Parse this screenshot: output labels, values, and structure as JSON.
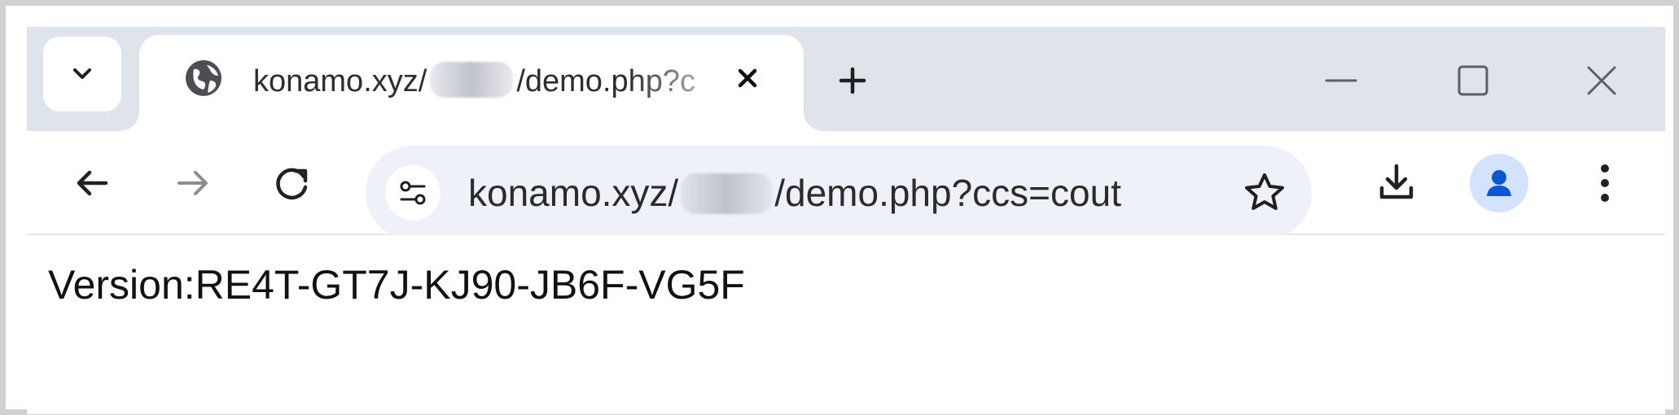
{
  "browser": {
    "tab": {
      "title_prefix": "konamo.xyz/",
      "title_suffix": "/demo.php?c",
      "favicon": "globe-icon",
      "close_icon": "close-icon"
    },
    "tabstrip": {
      "tab_search_icon": "chevron-down-icon",
      "new_tab_icon": "plus-icon"
    },
    "window_controls": {
      "minimize_icon": "minimize-icon",
      "maximize_icon": "maximize-icon",
      "close_icon": "close-icon"
    },
    "toolbar": {
      "back_icon": "back-arrow-icon",
      "forward_icon": "forward-arrow-icon",
      "reload_icon": "reload-icon",
      "site_info_icon": "site-info-icon",
      "bookmark_icon": "star-icon",
      "download_icon": "download-icon",
      "profile_icon": "person-icon",
      "menu_icon": "vertical-dots-icon"
    },
    "address_bar": {
      "url_prefix": "konamo.xyz/",
      "url_suffix": "/demo.php?ccs=cout"
    }
  },
  "page": {
    "version_text": "Version:RE4T-GT7J-KJ90-JB6F-VG5F"
  },
  "colors": {
    "tabstrip": "#dfe3ea",
    "omnibox": "#eef2f8",
    "profile_accent": "#0b57d0",
    "profile_background": "#d3e3fd"
  }
}
